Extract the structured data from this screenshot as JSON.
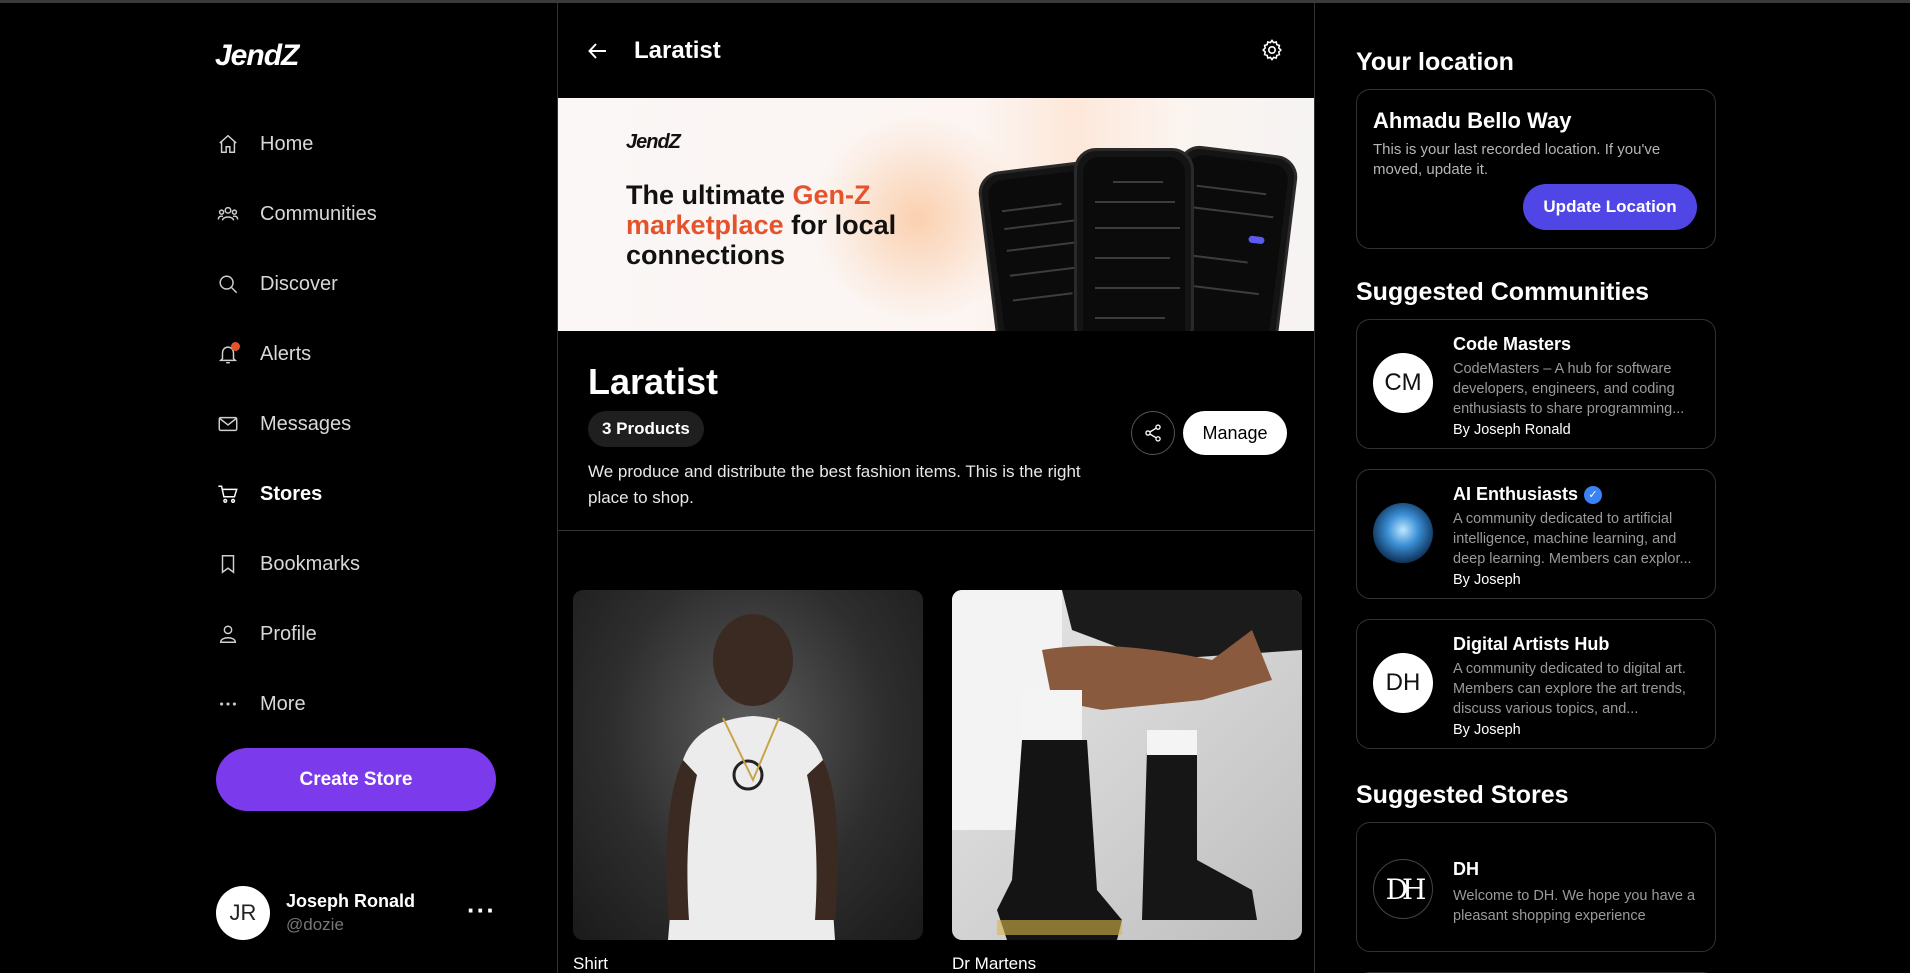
{
  "app": {
    "logo": "JendZ"
  },
  "nav": {
    "items": [
      {
        "label": "Home",
        "icon": "home-icon"
      },
      {
        "label": "Communities",
        "icon": "communities-icon"
      },
      {
        "label": "Discover",
        "icon": "search-icon"
      },
      {
        "label": "Alerts",
        "icon": "bell-icon",
        "has_badge": true
      },
      {
        "label": "Messages",
        "icon": "mail-icon"
      },
      {
        "label": "Stores",
        "icon": "cart-icon",
        "active": true
      },
      {
        "label": "Bookmarks",
        "icon": "bookmark-icon"
      },
      {
        "label": "Profile",
        "icon": "user-icon"
      },
      {
        "label": "More",
        "icon": "more-icon"
      }
    ],
    "create_store_label": "Create Store"
  },
  "current_user": {
    "initials": "JR",
    "name": "Joseph Ronald",
    "handle": "@dozie"
  },
  "header": {
    "title": "Laratist"
  },
  "banner": {
    "logo": "JendZ",
    "headline_part1": "The ultimate ",
    "headline_accent1": "Gen-Z",
    "headline_accent2": "marketplace",
    "headline_part2": " for local connections"
  },
  "store": {
    "name": "Laratist",
    "product_count": "3 Products",
    "description": "We produce and distribute the best fashion items. This is the right place to shop.",
    "manage_label": "Manage"
  },
  "products": [
    {
      "name": "Shirt"
    },
    {
      "name": "Dr Martens"
    }
  ],
  "location": {
    "section_title": "Your location",
    "address": "Ahmadu Bello Way",
    "note": "This is your last recorded location. If you've moved, update it.",
    "button_label": "Update Location"
  },
  "suggested_communities": {
    "section_title": "Suggested Communities",
    "items": [
      {
        "initials": "CM",
        "name": "Code Masters",
        "verified": false,
        "description": "CodeMasters – A hub for software developers, engineers, and coding enthusiasts to share programming...",
        "by": "By Joseph Ronald"
      },
      {
        "initials": "",
        "name": "AI Enthusiasts",
        "verified": true,
        "description": "A community dedicated to artificial intelligence, machine learning, and deep learning. Members can explor...",
        "by": "By Joseph"
      },
      {
        "initials": "DH",
        "name": "Digital Artists Hub",
        "verified": false,
        "description": "A community dedicated to digital art. Members can explore the art trends, discuss various topics, and...",
        "by": "By Joseph"
      }
    ]
  },
  "suggested_stores": {
    "section_title": "Suggested Stores",
    "items": [
      {
        "logo": "DH",
        "name": "DH",
        "description": "Welcome to DH. We hope you have a pleasant shopping experience"
      }
    ]
  },
  "colors": {
    "accent_purple": "#7c3aed",
    "accent_indigo": "#4f46e5",
    "alert_dot": "#e5532d",
    "banner_accent": "#e5532d"
  }
}
